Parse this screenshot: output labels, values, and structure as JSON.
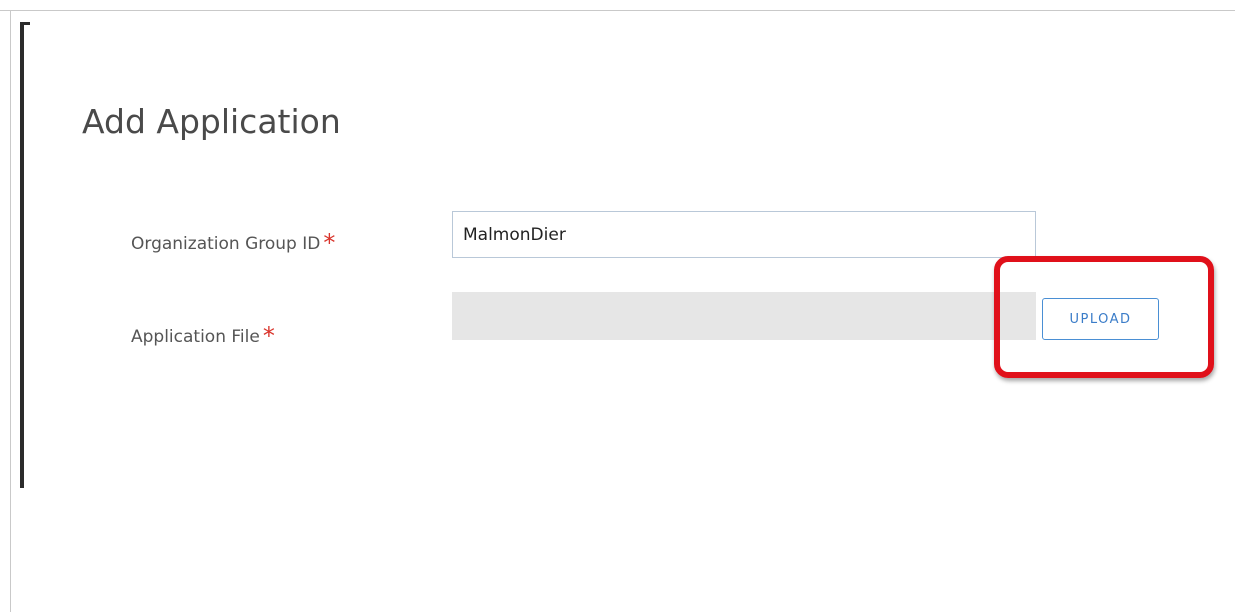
{
  "dialog": {
    "title": "Add Application"
  },
  "form": {
    "org_group": {
      "label": "Organization Group ID",
      "required_mark": "*",
      "value": "MalmonDier"
    },
    "app_file": {
      "label": "Application File",
      "required_mark": "*",
      "value": ""
    },
    "upload_label": "UPLOAD"
  },
  "colors": {
    "required": "#d9342b",
    "accent": "#3a7cc8",
    "highlight": "#e0101a"
  }
}
